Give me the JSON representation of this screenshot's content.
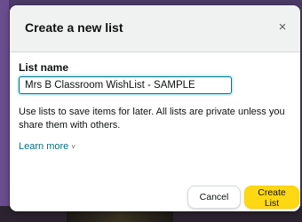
{
  "dialog": {
    "title": "Create a new list",
    "close_glyph": "×",
    "close_icon": "close-icon",
    "field_label": "List name",
    "input_value": "Mrs B Classroom WishList - SAMPLE",
    "helper_text": "Use lists to save items for later. All lists are private unless you share them with others.",
    "learn_more": "Learn more",
    "learn_more_chevron": "˅",
    "chevron_icon": "chevron-down-icon",
    "cancel_label": "Cancel",
    "create_label": "Create List"
  },
  "colors": {
    "link": "#007185",
    "primary_button": "#ffd814",
    "header_bg": "#f0f2f2",
    "input_focus": "#007185"
  }
}
